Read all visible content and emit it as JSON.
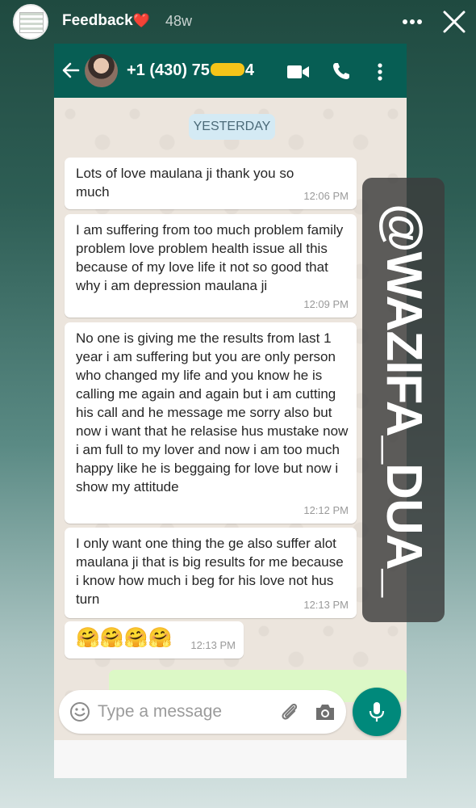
{
  "story": {
    "title": "Feedback",
    "heart": "❤️",
    "age": "48w",
    "more_icon": "more-horizontal-icon",
    "close_icon": "close-icon"
  },
  "chat": {
    "contact_prefix": "+1 (430) 75",
    "contact_suffix": "4",
    "date_chip": "YESTERDAY",
    "messages": [
      {
        "text": "Lots of love maulana ji thank you so much",
        "time": "12:06 PM"
      },
      {
        "text": "I am suffering from too much problem family problem love problem health issue all this because of my love life it not so good  that why i am depression maulana ji",
        "time": "12:09 PM"
      },
      {
        "text": "No one is giving me the results from last 1 year i am suffering but you are only person who changed my life and you know he is calling me again and again but i am cutting his call and he message me sorry also but now i want that he relasise hus mustake now i am full to my lover and now i am too much happy like he is beggaing for love but now i show my attitude",
        "time": "12:12 PM"
      },
      {
        "text": "I only want one thing the ge also suffer alot maulana ji that is big results for me because i know how much i beg for his love not hus turn",
        "time": "12:13 PM"
      },
      {
        "text": "🤗🤗🤗🤗",
        "time": "12:13 PM"
      }
    ],
    "composer_placeholder": "Type a message"
  },
  "watermark": "@WAZIFA_DUA_",
  "colors": {
    "whatsapp_header": "#075e54",
    "chat_background": "#ece5dd",
    "outgoing_bubble": "#dcf8c6",
    "mic_button": "#00897b",
    "redaction": "#f5c419"
  }
}
